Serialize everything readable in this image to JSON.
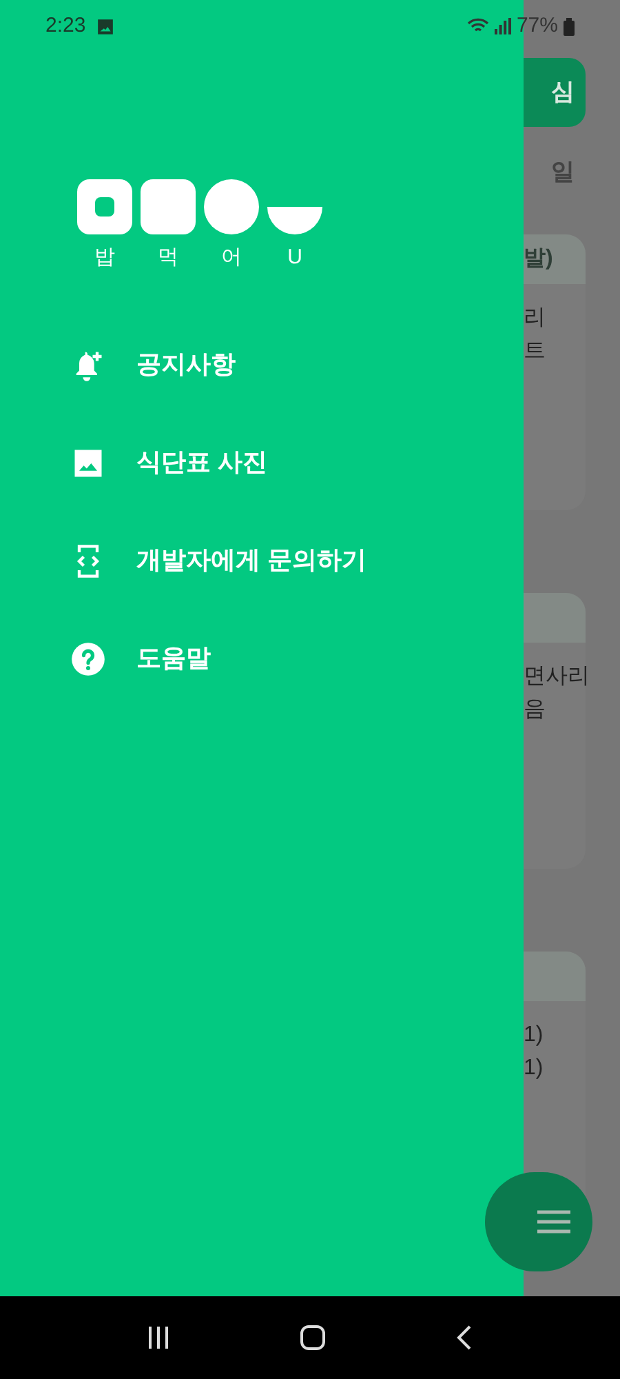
{
  "status_bar": {
    "time": "2:23",
    "battery": "77%"
  },
  "drawer": {
    "logo_letters": [
      "밥",
      "먹",
      "어",
      "U"
    ],
    "items": [
      {
        "kind": "notice",
        "label": "공지사항"
      },
      {
        "kind": "photo",
        "label": "식단표 사진"
      },
      {
        "kind": "contact",
        "label": "개발자에게 문의하기"
      },
      {
        "kind": "help",
        "label": "도움말"
      }
    ]
  },
  "background": {
    "button": "심",
    "day": "일",
    "cards": [
      {
        "title": "발)",
        "lines": [
          "리",
          "트"
        ]
      },
      {
        "lines": [
          "면사리",
          "음"
        ]
      },
      {
        "lines": [
          "1)",
          "1)"
        ]
      }
    ]
  }
}
